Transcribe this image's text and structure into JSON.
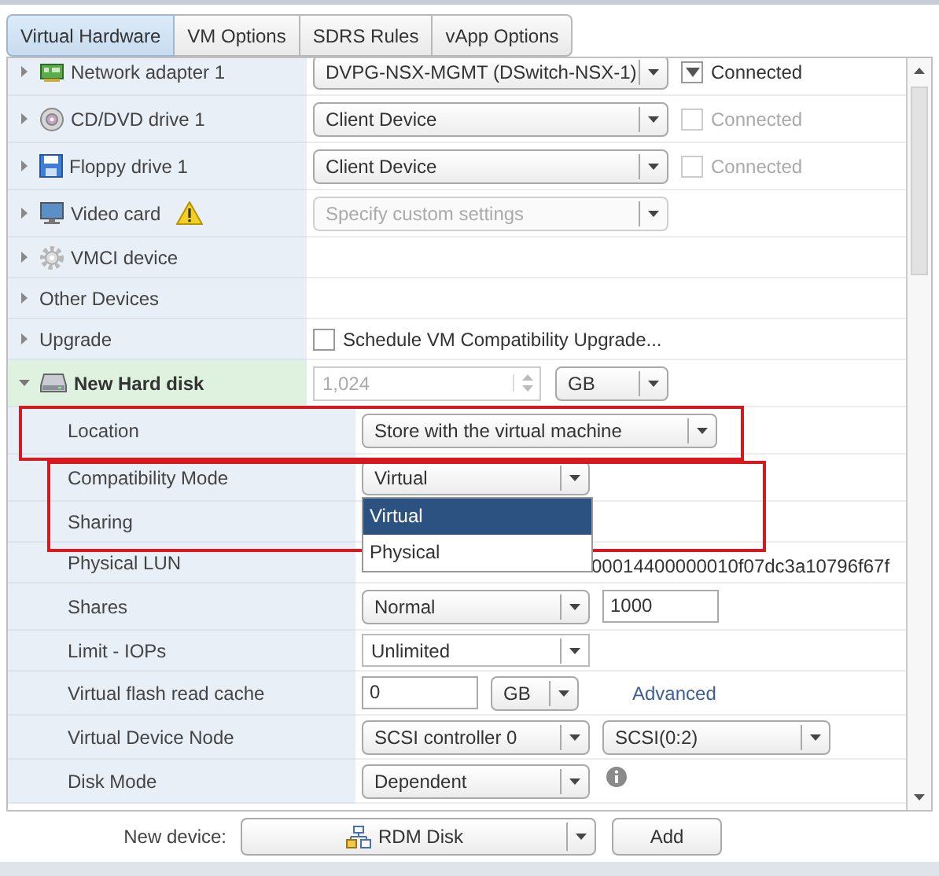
{
  "tabs": [
    {
      "label": "Virtual Hardware",
      "selected": true
    },
    {
      "label": "VM Options",
      "selected": false
    },
    {
      "label": "SDRS Rules",
      "selected": false
    },
    {
      "label": "vApp Options",
      "selected": false
    }
  ],
  "devices": [
    {
      "label": "Network adapter 1",
      "expanded": false,
      "selected": false,
      "controls": [
        {
          "kind": "select",
          "value": "DVPG-NSX-MGMT (DSwitch-NSX-1)",
          "disabled": false
        },
        {
          "kind": "checkbox",
          "label": "Connected",
          "checked": true,
          "disabled": false
        }
      ]
    },
    {
      "label": "CD/DVD drive 1",
      "expanded": false,
      "selected": false,
      "controls": [
        {
          "kind": "select",
          "value": "Client Device",
          "disabled": false
        },
        {
          "kind": "checkbox",
          "label": "Connected",
          "checked": false,
          "disabled": true
        }
      ]
    },
    {
      "label": "Floppy drive 1",
      "expanded": false,
      "selected": false,
      "controls": [
        {
          "kind": "select",
          "value": "Client Device",
          "disabled": false
        },
        {
          "kind": "checkbox",
          "label": "Connected",
          "checked": false,
          "disabled": true
        }
      ]
    },
    {
      "label": "Video card",
      "warning": true,
      "expanded": false,
      "selected": false,
      "controls": [
        {
          "kind": "select",
          "value": "Specify custom settings",
          "disabled": true
        }
      ]
    },
    {
      "label": "VMCI device",
      "expanded": false,
      "selected": false
    },
    {
      "label": "Other Devices",
      "expanded": false,
      "selected": false
    },
    {
      "label": "Upgrade",
      "expanded": false,
      "selected": false,
      "controls": [
        {
          "kind": "checkbox",
          "label": "Schedule VM Compatibility Upgrade...",
          "checked": false,
          "disabled": false
        }
      ]
    },
    {
      "label": "New Hard disk",
      "expanded": true,
      "selected": true,
      "controls": [
        {
          "kind": "spinner",
          "value": "1,024",
          "disabled": true
        },
        {
          "kind": "select",
          "value": "GB",
          "disabled": false
        }
      ],
      "children": [
        {
          "label": "Location",
          "controls": [
            {
              "kind": "select",
              "value": "Store with the virtual machine",
              "disabled": false
            }
          ]
        },
        {
          "label": "Compatibility Mode",
          "controls": [
            {
              "kind": "select",
              "value": "Virtual",
              "disabled": false,
              "open": true,
              "options": [
                {
                  "label": "Virtual",
                  "selected": true
                },
                {
                  "label": "Physical",
                  "selected": false
                }
              ]
            }
          ]
        },
        {
          "label": "Sharing"
        },
        {
          "label": "Physical LUN",
          "controls": [
            {
              "kind": "text",
              "value": "00014400000010f07dc3a10796f67f"
            }
          ]
        },
        {
          "label": "Shares",
          "controls": [
            {
              "kind": "select",
              "value": "Normal",
              "disabled": false
            },
            {
              "kind": "input",
              "value": "1000"
            }
          ]
        },
        {
          "label": "Limit - IOPs",
          "controls": [
            {
              "kind": "combo",
              "value": "Unlimited"
            }
          ]
        },
        {
          "label": "Virtual flash read cache",
          "controls": [
            {
              "kind": "input",
              "value": "0"
            },
            {
              "kind": "select",
              "value": "GB",
              "disabled": false
            },
            {
              "kind": "link",
              "label": "Advanced"
            }
          ]
        },
        {
          "label": "Virtual Device Node",
          "controls": [
            {
              "kind": "select",
              "value": "SCSI controller 0",
              "disabled": false
            },
            {
              "kind": "select",
              "value": "SCSI(0:2)",
              "disabled": false
            }
          ]
        },
        {
          "label": "Disk Mode",
          "controls": [
            {
              "kind": "select",
              "value": "Dependent",
              "disabled": false
            },
            {
              "kind": "info"
            }
          ]
        }
      ]
    }
  ],
  "footer": {
    "label": "New device:",
    "device": "RDM Disk",
    "add": "Add"
  }
}
